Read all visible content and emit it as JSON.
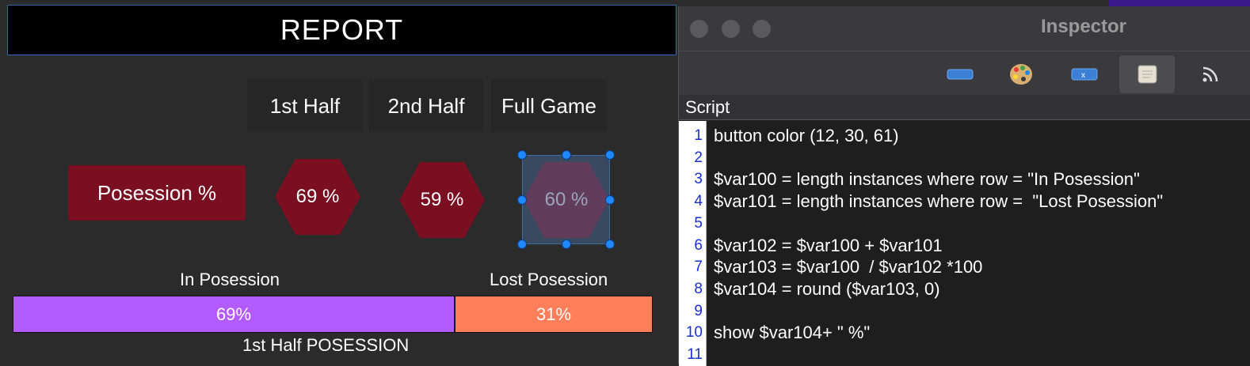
{
  "report": {
    "title": "REPORT",
    "tabs": [
      "1st Half",
      "2nd Half",
      "Full Game"
    ],
    "posession_label": "Posession %",
    "hexagons": [
      "69 %",
      "59 %",
      "60 %"
    ],
    "bar": {
      "label_left": "In Posession",
      "label_right": "Lost Posession",
      "in_posession_value": 69,
      "in_posession_text": "69%",
      "lost_value": 31,
      "lost_text": "31%",
      "caption": "1st Half POSESSION",
      "color_in": "#b25cff",
      "color_lost": "#ff7f5a"
    },
    "colors": {
      "hex_fill": "#7a0f22",
      "selected_hex_fill": "#6a3a5a"
    }
  },
  "inspector": {
    "title": "Inspector",
    "tools": [
      "button-widget-icon",
      "palette-icon",
      "variable-icon",
      "script-icon",
      "feed-icon"
    ],
    "section": "Script",
    "lines": [
      "button color (12, 30, 61)",
      "",
      "$var100 = length instances where row = \"In Posession\"",
      "$var101 = length instances where row =  \"Lost Posession\"",
      "",
      "$var102 = $var100 + $var101",
      "$var103 = $var100  / $var102 *100",
      "$var104 = round ($var103, 0)",
      "",
      "show $var104+ \" %\"",
      ""
    ],
    "line_numbers": [
      "1",
      "2",
      "3",
      "4",
      "5",
      "6",
      "7",
      "8",
      "9",
      "10",
      "11"
    ]
  }
}
